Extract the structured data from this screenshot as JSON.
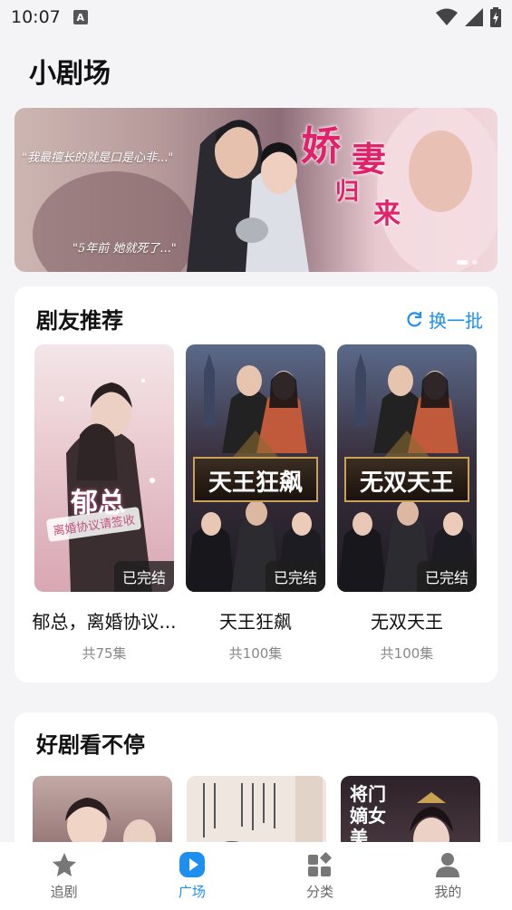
{
  "status": {
    "time": "10:07",
    "notif_badge": "A"
  },
  "page_title": "小剧场",
  "banner": {
    "quote1": "\"我最擅长的就是口是心非...\"",
    "quote2": "\"5年前 她就死了...\"",
    "title_chars": [
      "娇",
      "妻",
      "归",
      "来"
    ],
    "slide_index": 1,
    "slide_count": 2
  },
  "recommend": {
    "title": "剧友推荐",
    "refresh_label": "换一批",
    "items": [
      {
        "name": "郁总，离婚协议...",
        "episodes": "共75集",
        "badge": "已完结",
        "poster_title": "郁总",
        "poster_subtitle": "离婚协议请签收"
      },
      {
        "name": "天王狂飙",
        "episodes": "共100集",
        "badge": "已完结",
        "poster_title": "天王狂飙"
      },
      {
        "name": "无双天王",
        "episodes": "共100集",
        "badge": "已完结",
        "poster_title": "无双天王"
      }
    ]
  },
  "nonstop": {
    "title": "好剧看不停",
    "poster3_title": "将门嫡女美"
  },
  "tabs": [
    {
      "label": "追剧",
      "icon": "star-icon",
      "active": false
    },
    {
      "label": "广场",
      "icon": "play-icon",
      "active": true
    },
    {
      "label": "分类",
      "icon": "category-icon",
      "active": false
    },
    {
      "label": "我的",
      "icon": "user-icon",
      "active": false
    }
  ],
  "colors": {
    "accent": "#1d8ff0",
    "banner_title": "#e0226a"
  }
}
